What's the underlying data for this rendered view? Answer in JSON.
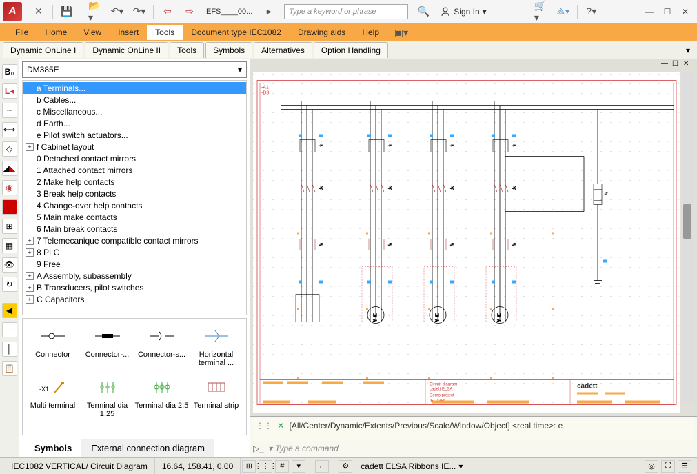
{
  "titlebar": {
    "doc_label": "EFS____00...",
    "search_placeholder": "Type a keyword or phrase",
    "signin": "Sign In"
  },
  "ribbon": {
    "items": [
      "File",
      "Home",
      "View",
      "Insert",
      "Tools",
      "Document type IEC1082",
      "Drawing aids",
      "Help"
    ],
    "active_index": 4
  },
  "tabs": {
    "items": [
      "Dynamic OnLine I",
      "Dynamic OnLine II",
      "Tools",
      "Symbols",
      "Alternatives",
      "Option Handling"
    ]
  },
  "panel": {
    "dropdown_value": "DM385E",
    "tree_items": [
      {
        "label": "a Terminals...",
        "expandable": false,
        "selected": true
      },
      {
        "label": "b Cables...",
        "expandable": false
      },
      {
        "label": "c Miscellaneous...",
        "expandable": false
      },
      {
        "label": "d Earth...",
        "expandable": false
      },
      {
        "label": "e Pilot switch actuators...",
        "expandable": false
      },
      {
        "label": "f Cabinet layout",
        "expandable": true
      },
      {
        "label": "0 Detached contact mirrors",
        "expandable": false
      },
      {
        "label": "1 Attached contact mirrors",
        "expandable": false
      },
      {
        "label": "2 Make help contacts",
        "expandable": false
      },
      {
        "label": "3 Break help contacts",
        "expandable": false
      },
      {
        "label": "4 Change-over help contacts",
        "expandable": false
      },
      {
        "label": "5 Main make contacts",
        "expandable": false
      },
      {
        "label": "6 Main break contacts",
        "expandable": false
      },
      {
        "label": "7 Telemecanique compatible contact mirrors",
        "expandable": true
      },
      {
        "label": "8 PLC",
        "expandable": true
      },
      {
        "label": "9 Free",
        "expandable": false
      },
      {
        "label": "A Assembly, subassembly",
        "expandable": true
      },
      {
        "label": "B Transducers, pilot switches",
        "expandable": true
      },
      {
        "label": "C Capacitors",
        "expandable": true
      }
    ],
    "symbols": [
      {
        "name": "Connector"
      },
      {
        "name": "Connector-..."
      },
      {
        "name": "Connector-s..."
      },
      {
        "name": "Horizontal terminal ..."
      },
      {
        "name": "Multi terminal"
      },
      {
        "name": "Terminal dia 1.25"
      },
      {
        "name": "Terminal dia 2.5"
      },
      {
        "name": "Terminal strip"
      }
    ],
    "tabs": {
      "items": [
        "Symbols",
        "External connection diagram"
      ],
      "active_index": 0
    }
  },
  "drawing": {
    "label_a1": "-A1",
    "label_d3": "-D3",
    "titleblock": {
      "line1": "Circuit diagram",
      "line2": "cadett ELSA",
      "line3": "Demo project",
      "line4": "IEC1385",
      "brand": "cadett"
    }
  },
  "command": {
    "history": "[All/Center/Dynamic/Extents/Previous/Scale/Window/Object] <real time>: e",
    "placeholder": "Type a command"
  },
  "status": {
    "doc_type": "IEC1082 VERTICAL/ Circuit Diagram",
    "coords": "16.64, 158.41, 0.00",
    "ribbon_label": "cadett ELSA Ribbons IE..."
  }
}
